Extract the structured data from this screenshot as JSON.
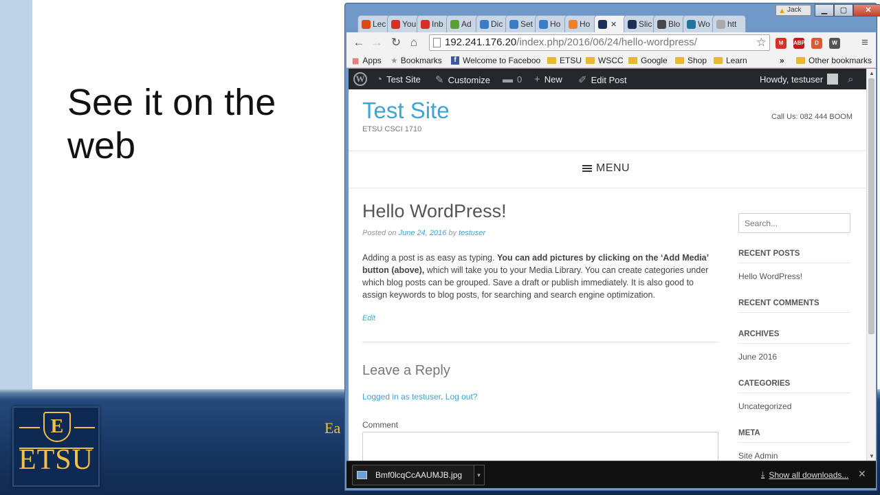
{
  "slide": {
    "title": "See it on the web",
    "footer_text": "Ea",
    "logo_text": "ETSU",
    "logo_emblem": "E"
  },
  "browser": {
    "profile_name": "Jack",
    "tabs": [
      {
        "label": "Lec",
        "icon": "ubuntu-icon",
        "color": "#dd4814"
      },
      {
        "label": "You",
        "icon": "gmail-icon",
        "color": "#d93025"
      },
      {
        "label": "Inb",
        "icon": "gmail-icon",
        "color": "#d93025"
      },
      {
        "label": "Ad",
        "icon": "leaf-icon",
        "color": "#5aa02c"
      },
      {
        "label": "Dic",
        "icon": "cloud-icon",
        "color": "#3a7cc6"
      },
      {
        "label": "Set",
        "icon": "cloud-icon",
        "color": "#3a7cc6"
      },
      {
        "label": "Ho",
        "icon": "line-icon",
        "color": "#3a7cc6"
      },
      {
        "label": "Ho",
        "icon": "orange-icon",
        "color": "#f48024"
      },
      {
        "label": "",
        "icon": "etsu-icon",
        "color": "#1d2f55",
        "active": true
      },
      {
        "label": "Slic",
        "icon": "etsu-icon",
        "color": "#1d2f55"
      },
      {
        "label": "Blo",
        "icon": "wordpress-icon",
        "color": "#464646"
      },
      {
        "label": "Wo",
        "icon": "wordpress-icon",
        "color": "#21759b"
      },
      {
        "label": "htt",
        "icon": "page-icon",
        "color": "#aaaaaa"
      }
    ],
    "url_host": "192.241.176.20",
    "url_path": "/index.php/2016/06/24/hello-wordpress/",
    "bookmarks": {
      "apps": "Apps",
      "bookmarks": "Bookmarks",
      "facebook": "Welcome to Faceboo",
      "etsu": "ETSU",
      "wscc": "WSCC",
      "google": "Google",
      "shop": "Shop",
      "learn": "Learn",
      "overflow": "»",
      "other": "Other bookmarks"
    },
    "extensions": [
      {
        "name": "gmail-ext-icon",
        "label": "M",
        "color": "#d93025"
      },
      {
        "name": "adblock-ext-icon",
        "label": "ABP",
        "color": "#c7161c"
      },
      {
        "name": "duckduckgo-ext-icon",
        "label": "D",
        "color": "#de5833"
      },
      {
        "name": "shield-ext-icon",
        "label": "W",
        "color": "#555555"
      }
    ]
  },
  "wp": {
    "adminbar": {
      "site": "Test Site",
      "customize": "Customize",
      "comments_count": "0",
      "new": "New",
      "edit_post": "Edit Post",
      "howdy": "Howdy, testuser"
    },
    "site_title": "Test Site",
    "tagline": "ETSU CSCI 1710",
    "call_us": "Call Us: 082 444 BOOM",
    "menu": "MENU",
    "post": {
      "title": "Hello WordPress!",
      "posted_on": "Posted on ",
      "date": "June 24, 2016",
      "by": " by ",
      "author": "testuser",
      "body_1": "Adding a post is as easy as typing. ",
      "body_bold": "You can add pictures by clicking on the ‘Add Media’ button (above),",
      "body_2": " which will take you to your Media Library. You can create categories under which blog posts can be grouped. Save a draft or publish immediately. It is also good to assign keywords to blog posts, for searching and search engine optimization.",
      "edit": "Edit"
    },
    "reply": {
      "title": "Leave a Reply",
      "logged_in": "Logged in as testuser",
      "log_out": "Log out?",
      "comment_label": "Comment"
    },
    "sidebar": {
      "search_placeholder": "Search...",
      "recent_posts": "RECENT POSTS",
      "recent_post_1": "Hello WordPress!",
      "recent_comments": "RECENT COMMENTS",
      "archives": "ARCHIVES",
      "archive_1": "June 2016",
      "categories": "CATEGORIES",
      "category_1": "Uncategorized",
      "meta": "META",
      "meta_1": "Site Admin"
    }
  },
  "downloads": {
    "file": "Bmf0lcqCcAAUMJB.jpg",
    "show_all": "Show all downloads..."
  }
}
